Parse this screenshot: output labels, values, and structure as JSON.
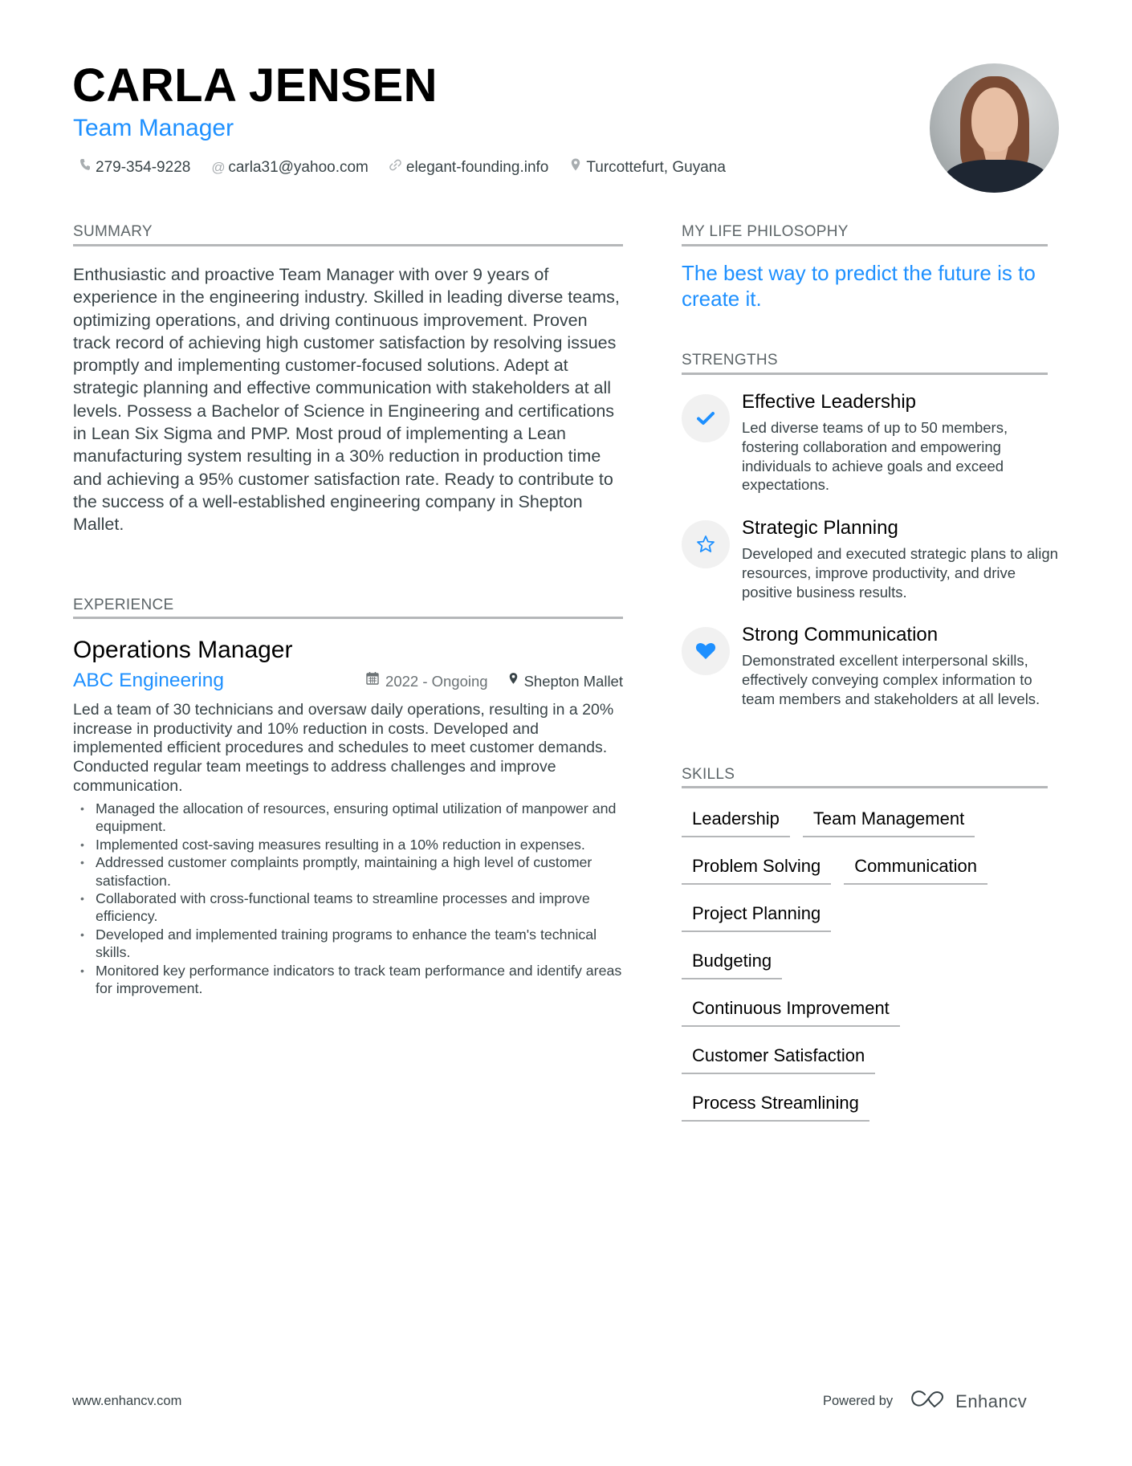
{
  "header": {
    "name": "CARLA JENSEN",
    "title": "Team Manager",
    "contacts": [
      {
        "icon": "phone-icon",
        "glyph": "✆",
        "text": "279-354-9228"
      },
      {
        "icon": "at-icon",
        "glyph": "@",
        "text": "carla31@yahoo.com"
      },
      {
        "icon": "link-icon",
        "glyph": "🔗︎",
        "text": "elegant-founding.info"
      },
      {
        "icon": "location-pin-icon",
        "glyph": "⚲",
        "text": "Turcottefurt, Guyana"
      }
    ]
  },
  "summary": {
    "heading": "SUMMARY",
    "text": "Enthusiastic and proactive Team Manager with over 9 years of experience in the engineering industry. Skilled in leading diverse teams, optimizing operations, and driving continuous improvement. Proven track record of achieving high customer satisfaction by resolving issues promptly and implementing customer-focused solutions. Adept at strategic planning and effective communication with stakeholders at all levels. Possess a Bachelor of Science in Engineering and certifications in Lean Six Sigma and PMP. Most proud of implementing a Lean manufacturing system resulting in a 30% reduction in production time and achieving a 95% customer satisfaction rate. Ready to contribute to the success of a well-established engineering company in Shepton Mallet."
  },
  "experience": {
    "heading": "EXPERIENCE",
    "jobs": [
      {
        "title": "Operations Manager",
        "company": "ABC Engineering",
        "dates": "2022 - Ongoing",
        "location": "Shepton Mallet",
        "description": "Led a team of 30 technicians and oversaw daily operations, resulting in a 20% increase in productivity and 10% reduction in costs. Developed and implemented efficient procedures and schedules to meet customer demands. Conducted regular team meetings to address challenges and improve communication.",
        "bullets": [
          "Managed the allocation of resources, ensuring optimal utilization of manpower and equipment.",
          "Implemented cost-saving measures resulting in a 10% reduction in expenses.",
          "Addressed customer complaints promptly, maintaining a high level of customer satisfaction.",
          "Collaborated with cross-functional teams to streamline processes and improve efficiency.",
          "Developed and implemented training programs to enhance the team's technical skills.",
          "Monitored key performance indicators to track team performance and identify areas for improvement."
        ]
      }
    ]
  },
  "philosophy": {
    "heading": "MY LIFE PHILOSOPHY",
    "quote": "The best way to predict the future is to create it."
  },
  "strengths": {
    "heading": "STRENGTHS",
    "items": [
      {
        "icon": "checkmark-icon",
        "title": "Effective Leadership",
        "description": "Led diverse teams of up to 50 members, fostering collaboration and empowering individuals to achieve goals and exceed expectations."
      },
      {
        "icon": "star-icon",
        "title": "Strategic Planning",
        "description": "Developed and executed strategic plans to align resources, improve productivity, and drive positive business results."
      },
      {
        "icon": "heart-icon",
        "title": "Strong Communication",
        "description": "Demonstrated excellent interpersonal skills, effectively conveying complex information to team members and stakeholders at all levels."
      }
    ]
  },
  "skills": {
    "heading": "SKILLS",
    "items": [
      "Leadership",
      "Team Management",
      "Problem Solving",
      "Communication",
      "Project Planning",
      "Budgeting",
      "Continuous Improvement",
      "Customer Satisfaction",
      "Process Streamlining"
    ]
  },
  "footer": {
    "website": "www.enhancv.com",
    "powered_by": "Powered by",
    "brand": "Enhancv"
  },
  "colors": {
    "accent": "#1e90ff",
    "text": "#384347",
    "heading": "#5d6568",
    "rule": "#b5b7b9",
    "badge_bg": "#f1f1f1"
  }
}
